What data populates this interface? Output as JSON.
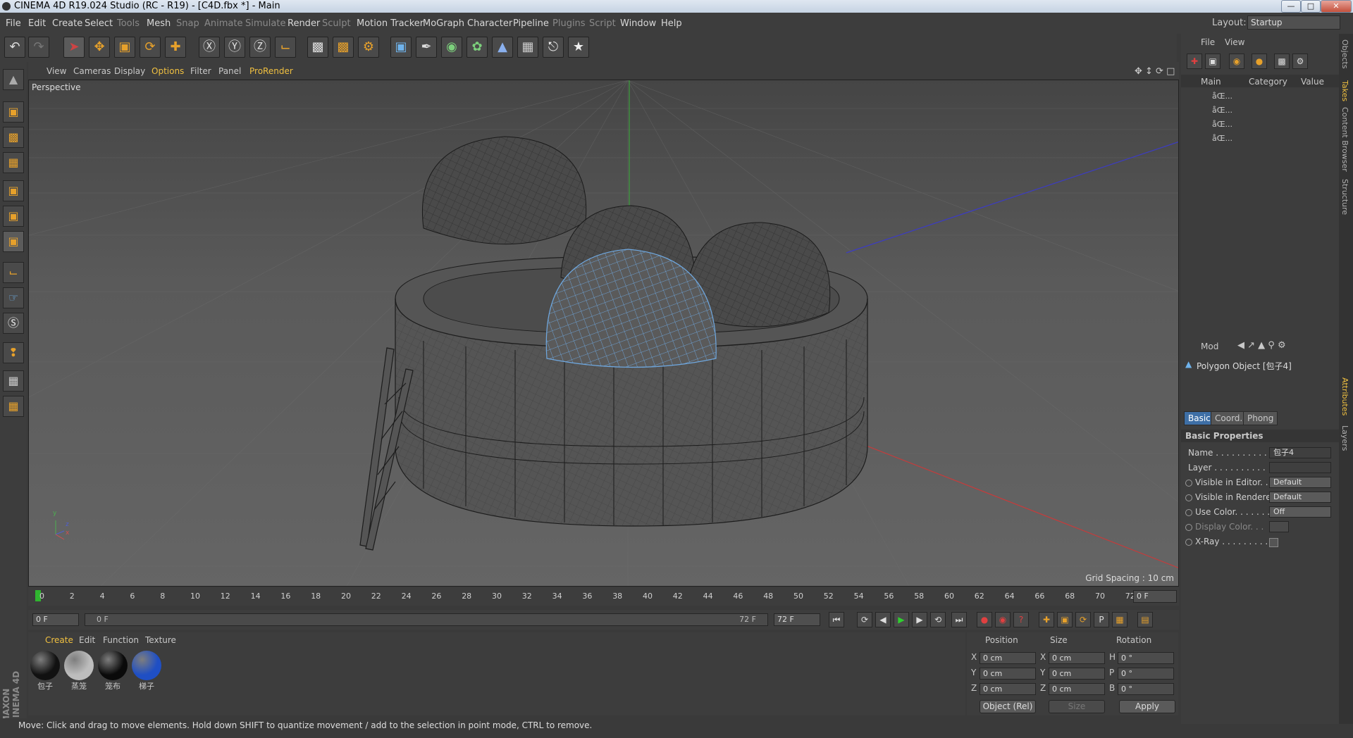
{
  "window": {
    "title": "CINEMA 4D R19.024 Studio (RC - R19) - [C4D.fbx *] - Main",
    "minimize": "—",
    "maximize": "□",
    "close": "✕"
  },
  "menubar": {
    "items": [
      "File",
      "Edit",
      "Create",
      "Select",
      "Tools",
      "Mesh",
      "Snap",
      "Animate",
      "Simulate",
      "Render",
      "Sculpt",
      "Motion Tracker",
      "MoGraph",
      "Character",
      "Pipeline",
      "Plugins",
      "Script",
      "Window",
      "Help"
    ],
    "layout_label": "Layout:",
    "layout_value": "Startup"
  },
  "viewport": {
    "menu": [
      "View",
      "Cameras",
      "Display",
      "Options",
      "Filter",
      "Panel",
      "ProRender"
    ],
    "label": "Perspective",
    "grid_spacing": "Grid Spacing : 10 cm",
    "axis_y": "y",
    "axis_z": "z",
    "axis_x": "x"
  },
  "timeline": {
    "ticks": [
      "0",
      "2",
      "4",
      "6",
      "8",
      "10",
      "12",
      "14",
      "16",
      "18",
      "20",
      "22",
      "24",
      "26",
      "28",
      "30",
      "32",
      "34",
      "36",
      "38",
      "40",
      "42",
      "44",
      "46",
      "48",
      "50",
      "52",
      "54",
      "56",
      "58",
      "60",
      "62",
      "64",
      "66",
      "68",
      "70",
      "72"
    ],
    "current_frame": "0 F",
    "start_frame": "0 F",
    "range_start": "0 F",
    "range_end": "72 F",
    "end_frame": "72 F"
  },
  "material_manager": {
    "menu": [
      "Create",
      "Edit",
      "Function",
      "Texture"
    ],
    "materials": [
      {
        "name": "包子",
        "color": "#111111"
      },
      {
        "name": "蒸笼",
        "color": "#bdbdbd"
      },
      {
        "name": "笼布",
        "color": "#0a0a0a"
      },
      {
        "name": "梯子",
        "color": "#1f4fc4"
      }
    ]
  },
  "coordinates": {
    "headers": [
      "Position",
      "Size",
      "Rotation"
    ],
    "rows": [
      {
        "axis": "X",
        "pos": "0 cm",
        "size_axis": "X",
        "size": "0 cm",
        "rot_axis": "H",
        "rot": "0 °"
      },
      {
        "axis": "Y",
        "pos": "0 cm",
        "size_axis": "Y",
        "size": "0 cm",
        "rot_axis": "P",
        "rot": "0 °"
      },
      {
        "axis": "Z",
        "pos": "0 cm",
        "size_axis": "Z",
        "size": "0 cm",
        "rot_axis": "B",
        "rot": "0 °"
      }
    ],
    "mode": "Object (Rel)",
    "size_mode": "Size",
    "apply": "Apply"
  },
  "status": "Move: Click and drag to move elements. Hold down SHIFT to quantize movement / add to the selection in point mode, CTRL to remove.",
  "brand": "MAXON CINEMA 4D",
  "takes": {
    "menu": [
      "File",
      "View"
    ],
    "columns": [
      "Main",
      "Category",
      "Value"
    ],
    "rows": [
      "åŒ...",
      "åŒ...",
      "åŒ...",
      "åŒ..."
    ]
  },
  "attributes": {
    "mode": "Mod",
    "object_title": "Polygon Object [包子4]",
    "tabs": [
      "Basic",
      "Coord.",
      "Phong"
    ],
    "section": "Basic Properties",
    "rows": [
      {
        "label": "Name . . . . . . . . . . .",
        "value": "包子4"
      },
      {
        "label": "Layer . . . . . . . . . .",
        "value": ""
      },
      {
        "label": "Visible in Editor. . .",
        "value": "Default"
      },
      {
        "label": "Visible in Renderer",
        "value": "Default"
      },
      {
        "label": "Use Color. . . . . . . .",
        "value": "Off"
      },
      {
        "label": "Display Color. . .",
        "value": ""
      },
      {
        "label": "X-Ray . . . . . . . . . .",
        "value": ""
      }
    ]
  },
  "side_tabs": [
    "Objects",
    "Takes",
    "Content Browser",
    "Structure",
    "Attributes",
    "Layers"
  ]
}
